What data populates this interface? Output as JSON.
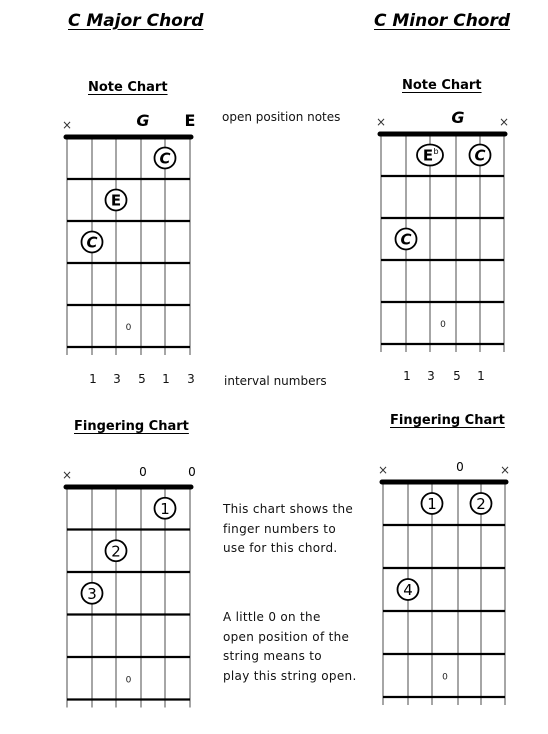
{
  "colors": {
    "ink": "#000000",
    "string": "#777777",
    "background": "#ffffff"
  },
  "major": {
    "title": "C Major Chord",
    "note_chart": {
      "title": "Note Chart",
      "open_string_labels": [
        "×",
        "",
        "",
        "G",
        "",
        "E"
      ],
      "markers": [
        {
          "string": 5,
          "fret": 1,
          "label": "C"
        },
        {
          "string": 3,
          "fret": 2,
          "label": "E"
        },
        {
          "string": 2,
          "fret": 3,
          "label": "C"
        }
      ],
      "fret_marker": {
        "fret": 5,
        "label": "0"
      },
      "intervals": [
        "",
        "1",
        "3",
        "5",
        "1",
        "3"
      ]
    },
    "fingering_chart": {
      "title": "Fingering Chart",
      "open_string_labels": [
        "×",
        "",
        "",
        "0",
        "",
        "0"
      ],
      "markers": [
        {
          "string": 5,
          "fret": 1,
          "label": "1"
        },
        {
          "string": 3,
          "fret": 2,
          "label": "2"
        },
        {
          "string": 2,
          "fret": 3,
          "label": "3"
        }
      ],
      "fret_marker": {
        "fret": 5,
        "label": "0"
      }
    }
  },
  "minor": {
    "title": "C Minor Chord",
    "note_chart": {
      "title": "Note Chart",
      "open_string_labels": [
        "×",
        "",
        "",
        "G",
        "",
        "×"
      ],
      "markers": [
        {
          "string": 3,
          "fret": 1,
          "label": "E",
          "sup": "b"
        },
        {
          "string": 5,
          "fret": 1,
          "label": "C"
        },
        {
          "string": 2,
          "fret": 3,
          "label": "C"
        }
      ],
      "fret_marker": {
        "fret": 5,
        "label": "0"
      },
      "intervals": [
        "",
        "1",
        "3",
        "5",
        "1",
        ""
      ]
    },
    "fingering_chart": {
      "title": "Fingering Chart",
      "open_string_labels": [
        "×",
        "",
        "",
        "0",
        "",
        "×"
      ],
      "markers": [
        {
          "string": 3,
          "fret": 1,
          "label": "1"
        },
        {
          "string": 5,
          "fret": 1,
          "label": "2"
        },
        {
          "string": 2,
          "fret": 3,
          "label": "4"
        }
      ],
      "fret_marker": {
        "fret": 5,
        "label": "0"
      }
    }
  },
  "annotations": {
    "open_position_notes": "open position notes",
    "interval_numbers": "interval numbers",
    "fingering_explanation": [
      "This chart shows the",
      "finger numbers to",
      "use for this chord."
    ],
    "open_explanation": [
      "A little 0 on the",
      "open position of the",
      "string means to",
      "play this string open."
    ]
  }
}
